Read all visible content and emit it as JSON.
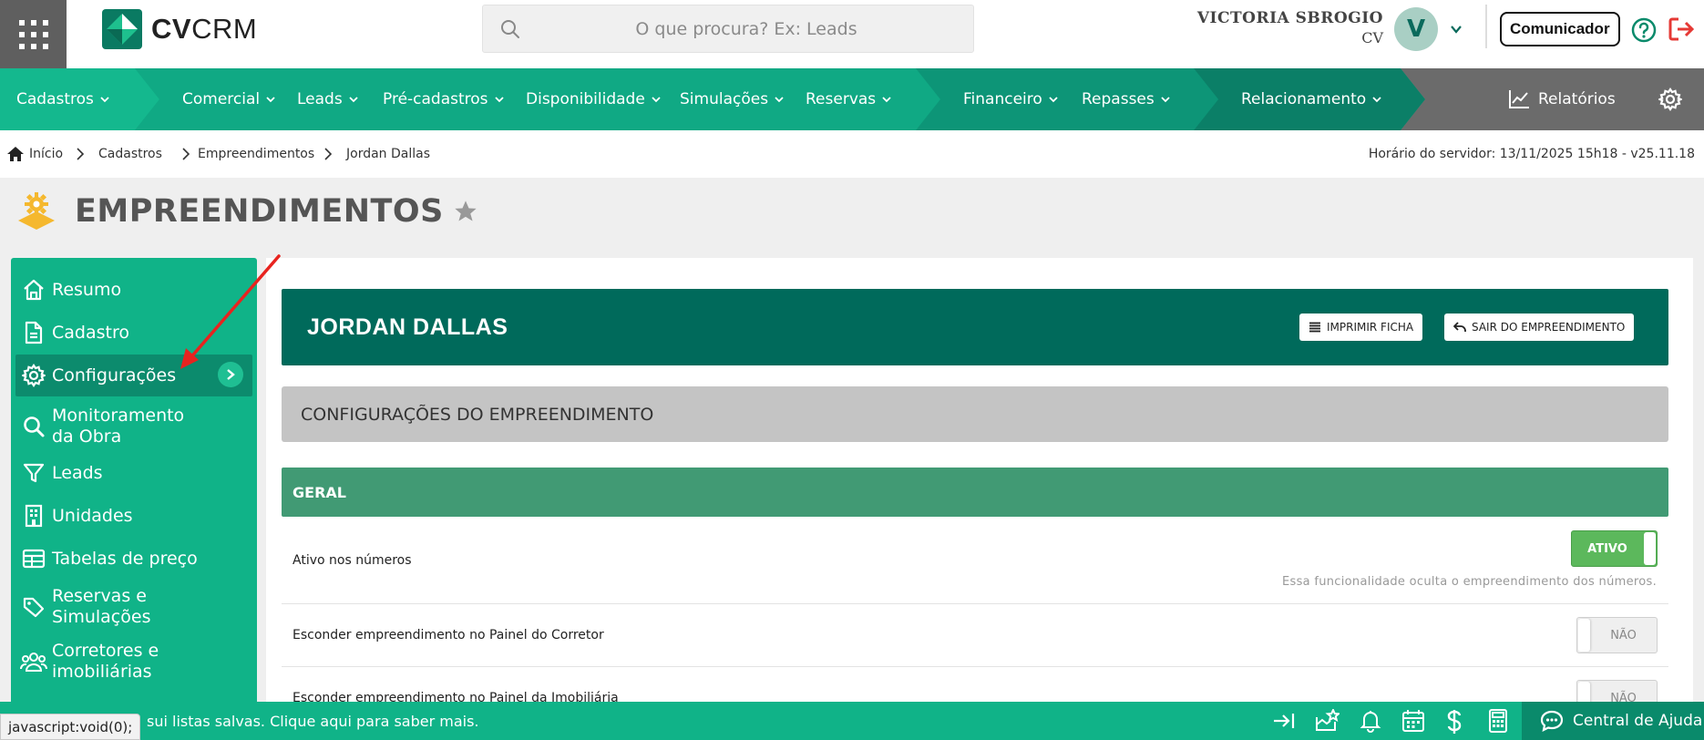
{
  "header": {
    "logo_bold": "CV",
    "logo_light": "CRM",
    "search_placeholder": "O que procura? Ex: Leads",
    "user_name": "VICTORIA SBROGIO",
    "user_role": "CV",
    "avatar_letter": "V",
    "comunicador_label": "Comunicador"
  },
  "nav": {
    "items": [
      {
        "label": "Cadastros"
      },
      {
        "label": "Comercial"
      },
      {
        "label": "Leads"
      },
      {
        "label": "Pré-cadastros"
      },
      {
        "label": "Disponibilidade"
      },
      {
        "label": "Simulações"
      },
      {
        "label": "Reservas"
      },
      {
        "label": "Financeiro"
      },
      {
        "label": "Repasses"
      },
      {
        "label": "Relacionamento"
      },
      {
        "label": "Relatórios"
      }
    ]
  },
  "breadcrumb": {
    "items": [
      "Início",
      "Cadastros",
      "Empreendimentos",
      "Jordan Dallas"
    ],
    "server_time": "Horário do servidor: 13/11/2025 15h18 - v25.11.18"
  },
  "page": {
    "title": "EMPREENDIMENTOS"
  },
  "sidebar": {
    "items": [
      {
        "label": "Resumo",
        "icon": "home-icon"
      },
      {
        "label": "Cadastro",
        "icon": "document-icon"
      },
      {
        "label": "Configurações",
        "icon": "gear-icon"
      },
      {
        "label": "Monitoramento da Obra",
        "icon": "search-icon"
      },
      {
        "label": "Leads",
        "icon": "filter-icon"
      },
      {
        "label": "Unidades",
        "icon": "building-icon"
      },
      {
        "label": "Tabelas de preço",
        "icon": "table-icon"
      },
      {
        "label": "Reservas e Simulações",
        "icon": "tag-icon"
      },
      {
        "label": "Corretores e imobiliárias",
        "icon": "users-icon"
      }
    ]
  },
  "empreendimento": {
    "name": "JORDAN DALLAS",
    "print_label": "IMPRIMIR FICHA",
    "exit_label": "SAIR DO EMPREENDIMENTO"
  },
  "config": {
    "section_title": "CONFIGURAÇÕES DO EMPREENDIMENTO",
    "group_title": "GERAL",
    "rows": [
      {
        "label": "Ativo nos números",
        "toggle": "ATIVO",
        "on": true,
        "hint": "Essa funcionalidade oculta o empreendimento dos números."
      },
      {
        "label": "Esconder empreendimento no Painel do Corretor",
        "toggle": "NÃO",
        "on": false
      },
      {
        "label": "Esconder empreendimento no Painel da Imobiliária",
        "toggle": "NÃO",
        "on": false
      }
    ]
  },
  "bottom": {
    "message": "sui listas salvas. Clique aqui para saber mais.",
    "help_center": "Central de Ajuda",
    "status_url": "javascript:void(0);"
  },
  "colors": {
    "brand_green": "#10b388",
    "dark_green": "#006a5b",
    "accent_red": "#e53935"
  }
}
